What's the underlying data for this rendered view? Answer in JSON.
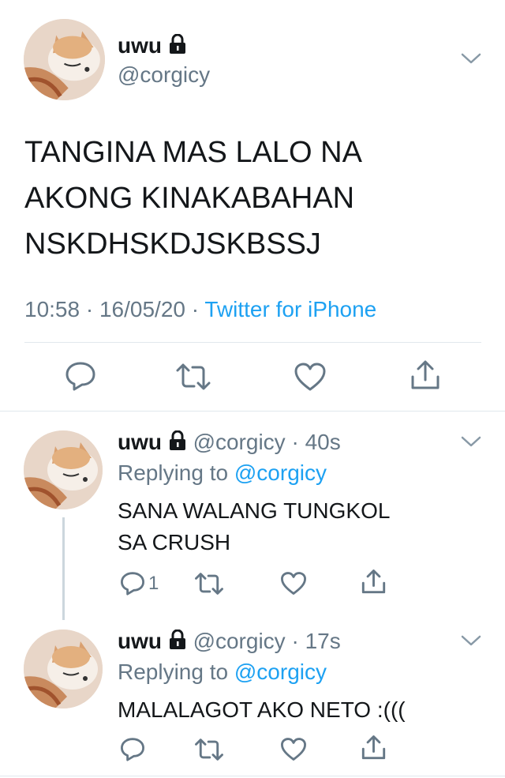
{
  "main_tweet": {
    "display_name": "uwu",
    "handle": "@corgicy",
    "text_lines": [
      "TANGINA MAS LALO NA",
      "AKONG KINAKABAHAN",
      "NSKDHSKDJSKBSSJ"
    ],
    "time": "10:58",
    "date": "16/05/20",
    "source": "Twitter for iPhone",
    "separator": "·"
  },
  "replies": [
    {
      "display_name": "uwu",
      "handle": "@corgicy",
      "age": "40s",
      "replying_label": "Replying to",
      "replying_to": "@corgicy",
      "text_lines": [
        "SANA WALANG TUNGKOL",
        "SA CRUSH"
      ],
      "reply_count": "1"
    },
    {
      "display_name": "uwu",
      "handle": "@corgicy",
      "age": "17s",
      "replying_label": "Replying to",
      "replying_to": "@corgicy",
      "text_lines": [
        "MALALAGOT AKO NETO :((("
      ],
      "reply_count": ""
    }
  ],
  "colors": {
    "link": "#1da1f2",
    "secondary": "#657786",
    "icon": "#657786",
    "divider": "#e1e8ed"
  },
  "icons": [
    "lock-icon",
    "chevron-down-icon",
    "reply-icon",
    "retweet-icon",
    "like-icon",
    "share-icon"
  ]
}
